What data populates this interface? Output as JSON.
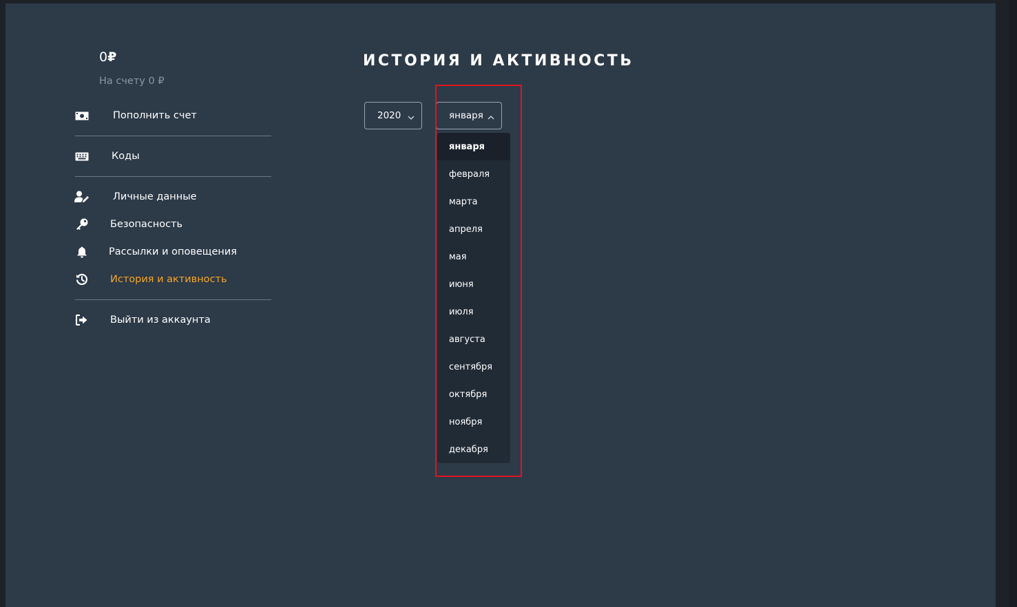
{
  "account": {
    "balance_amount": "0",
    "currency_symbol": "₽",
    "balance_note": "На счету 0 ₽"
  },
  "sidebar": {
    "items": [
      {
        "label": "Пополнить счет",
        "icon": "money-icon"
      },
      {
        "label": "Коды",
        "icon": "keyboard-icon"
      },
      {
        "label": "Личные данные",
        "icon": "user-edit-icon"
      },
      {
        "label": "Безопасность",
        "icon": "key-icon"
      },
      {
        "label": "Рассылки и оповещения",
        "icon": "bell-icon"
      },
      {
        "label": "История и активность",
        "icon": "history-icon",
        "active": true
      },
      {
        "label": "Выйти из аккаунта",
        "icon": "sign-out-icon"
      }
    ]
  },
  "main": {
    "title": "История и активность",
    "year_select": {
      "value": "2020"
    },
    "month_select": {
      "value": "января",
      "options": [
        "января",
        "февраля",
        "марта",
        "апреля",
        "мая",
        "июня",
        "июля",
        "августа",
        "сентября",
        "октября",
        "ноября",
        "декабря"
      ],
      "selected_option": "января"
    }
  },
  "colors": {
    "background": "#2d3a48",
    "accent_active": "#f5a623",
    "highlight_border": "#e0141e",
    "dropdown_bg": "#212b36"
  }
}
